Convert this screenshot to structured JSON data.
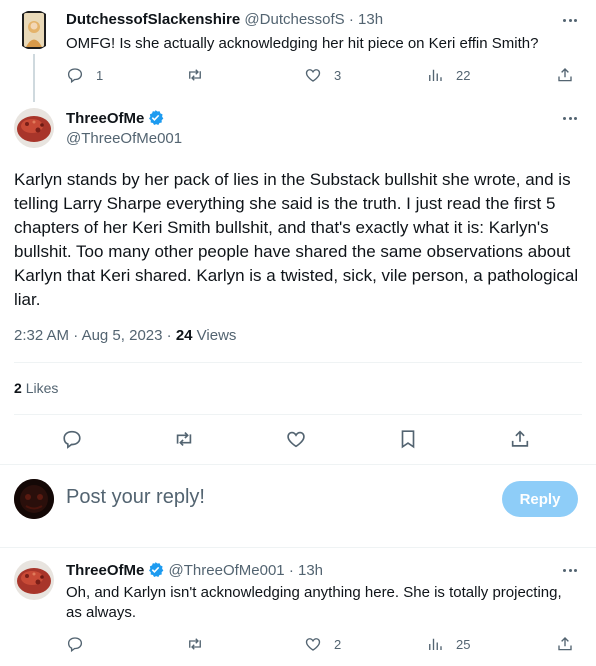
{
  "tweet1": {
    "display_name": "DutchessofSlackenshire",
    "handle": "@DutchessofS",
    "separator": "·",
    "time": "13h",
    "text": "OMFG!  Is she actually acknowledging her hit piece on Keri effin Smith?",
    "replies": "1",
    "likes": "3",
    "views": "22"
  },
  "main": {
    "display_name": "ThreeOfMe",
    "handle": "@ThreeOfMe001",
    "text": "Karlyn stands by her pack of lies in the Substack bullshit she wrote, and is telling Larry Sharpe everything she said is the truth. I just read the first 5 chapters of her Keri Smith bullshit, and that's exactly what it is: Karlyn's bullshit. Too many other people have shared the same observations about Karlyn that Keri shared. Karlyn is a twisted, sick, vile person, a pathological liar.",
    "time": "2:32 AM",
    "date": "Aug 5, 2023",
    "dot": "·",
    "views_count": "24",
    "views_label": "Views",
    "likes_count": "2",
    "likes_label": "Likes"
  },
  "reply_box": {
    "placeholder": "Post your reply!",
    "button": "Reply"
  },
  "tweet3": {
    "display_name": "ThreeOfMe",
    "handle": "@ThreeOfMe001",
    "separator": "·",
    "time": "13h",
    "text": "Oh, and Karlyn isn't acknowledging anything here. She is totally projecting, as always.",
    "likes": "2",
    "views": "25"
  },
  "colors": {
    "accent": "#1d9bf0",
    "reply_button_disabled": "#8ecdf8",
    "muted": "#536471",
    "text": "#0f1419"
  },
  "icons": [
    "reply-icon",
    "retweet-icon",
    "like-icon",
    "views-icon",
    "share-icon",
    "bookmark-icon",
    "more-icon",
    "verified-badge-icon"
  ]
}
